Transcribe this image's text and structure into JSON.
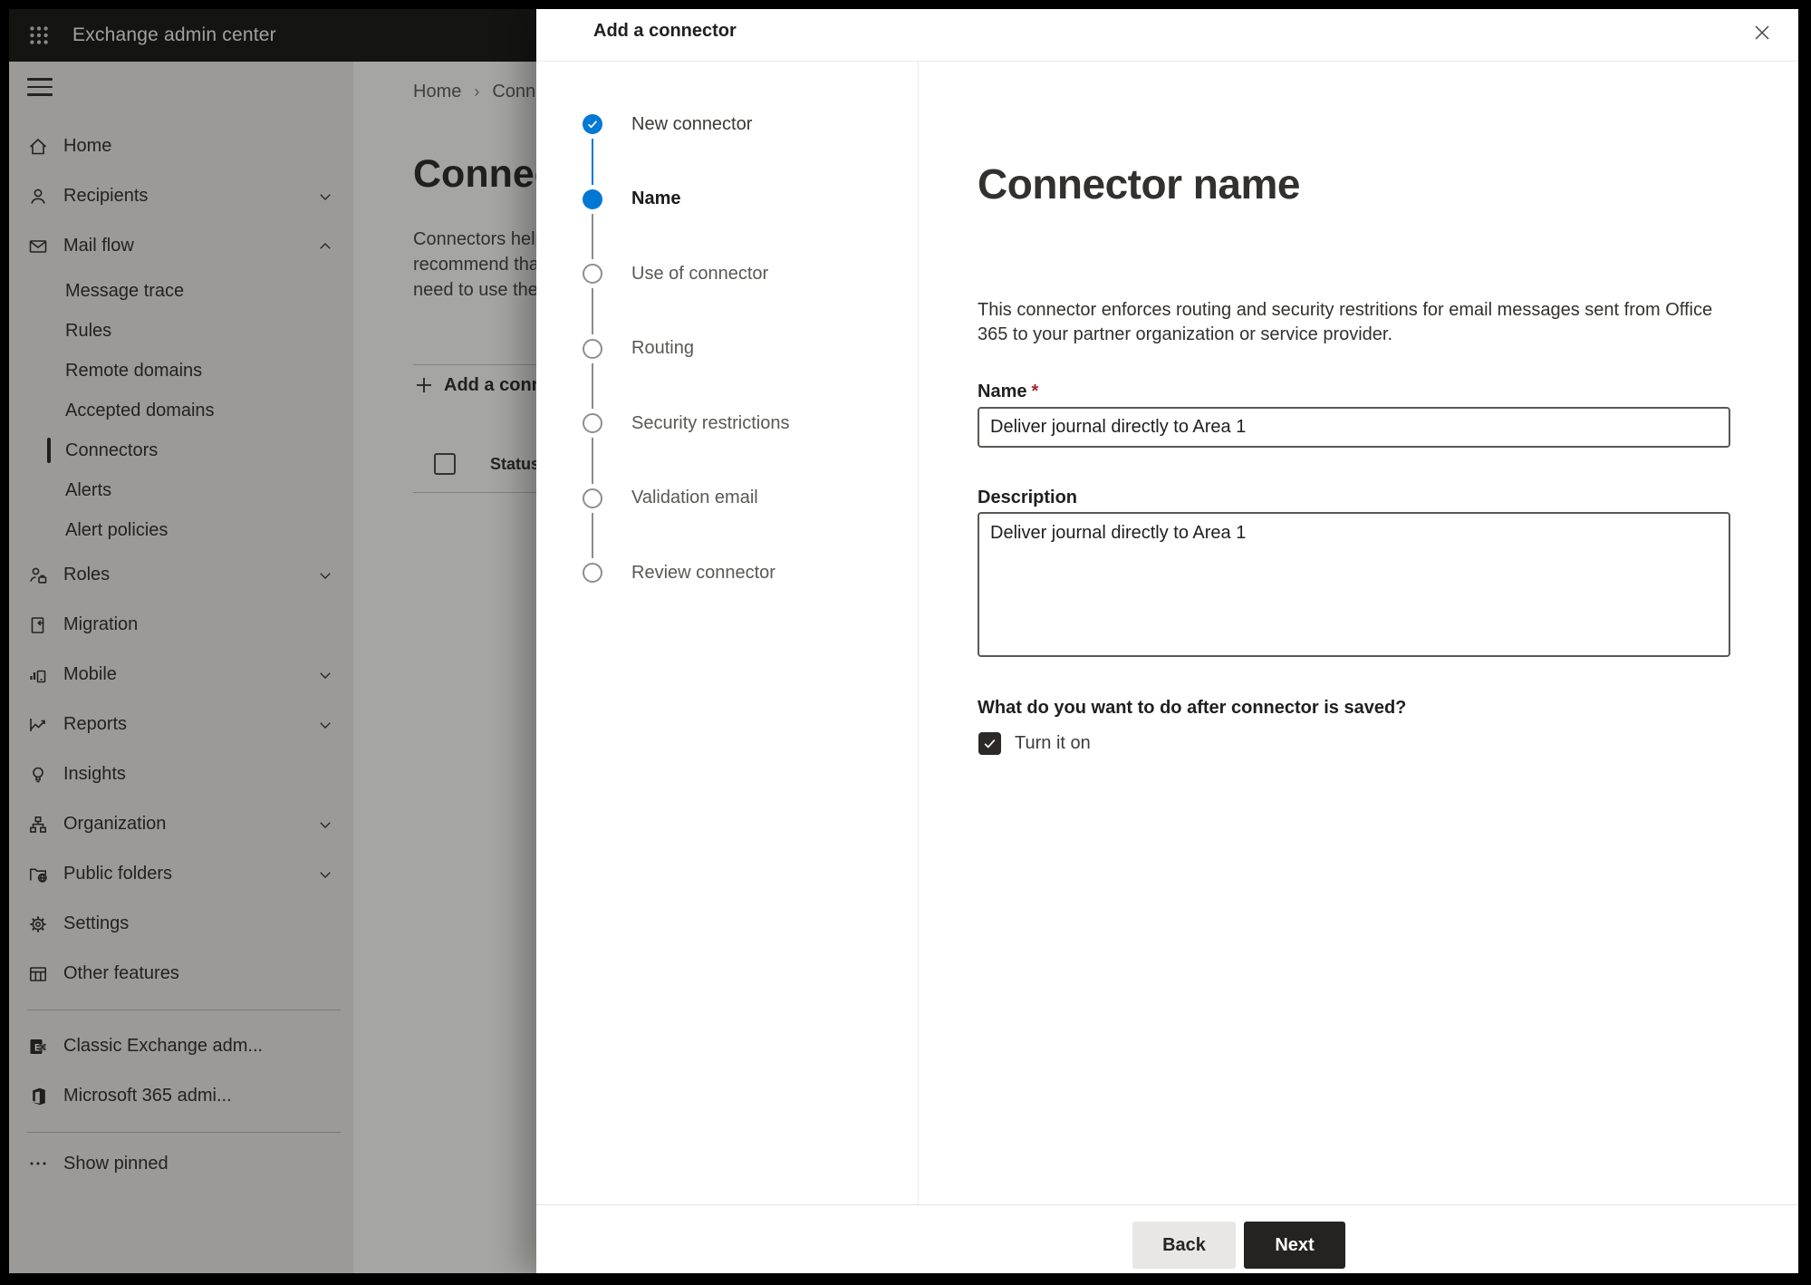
{
  "app": {
    "title": "Exchange admin center"
  },
  "sidebar": {
    "items": [
      {
        "label": "Home",
        "icon": "home-icon",
        "type": "top"
      },
      {
        "label": "Recipients",
        "icon": "person-icon",
        "type": "top",
        "chevron": "down"
      },
      {
        "label": "Mail flow",
        "icon": "mail-icon",
        "type": "top",
        "chevron": "up"
      },
      {
        "label": "Message trace",
        "type": "sub"
      },
      {
        "label": "Rules",
        "type": "sub"
      },
      {
        "label": "Remote domains",
        "type": "sub"
      },
      {
        "label": "Accepted domains",
        "type": "sub"
      },
      {
        "label": "Connectors",
        "type": "sub",
        "selected": true
      },
      {
        "label": "Alerts",
        "type": "sub"
      },
      {
        "label": "Alert policies",
        "type": "sub"
      },
      {
        "label": "Roles",
        "icon": "roles-icon",
        "type": "top",
        "chevron": "down"
      },
      {
        "label": "Migration",
        "icon": "migration-icon",
        "type": "top"
      },
      {
        "label": "Mobile",
        "icon": "mobile-icon",
        "type": "top",
        "chevron": "down"
      },
      {
        "label": "Reports",
        "icon": "reports-icon",
        "type": "top",
        "chevron": "down"
      },
      {
        "label": "Insights",
        "icon": "insights-icon",
        "type": "top"
      },
      {
        "label": "Organization",
        "icon": "organization-icon",
        "type": "top",
        "chevron": "down"
      },
      {
        "label": "Public folders",
        "icon": "public-folders-icon",
        "type": "top",
        "chevron": "down"
      },
      {
        "label": "Settings",
        "icon": "settings-icon",
        "type": "top"
      },
      {
        "label": "Other features",
        "icon": "other-features-icon",
        "type": "top"
      },
      {
        "type": "divider"
      },
      {
        "label": "Classic Exchange adm...",
        "icon": "exchange-logo-icon",
        "type": "top"
      },
      {
        "label": "Microsoft 365 admi...",
        "icon": "microsoft365-logo-icon",
        "type": "top"
      },
      {
        "type": "divider"
      },
      {
        "label": "Show pinned",
        "icon": "ellipsis-icon",
        "type": "sp"
      }
    ]
  },
  "page": {
    "breadcrumb": {
      "home": "Home",
      "separator": "›",
      "current": "Conne"
    },
    "heading": "Connect",
    "intro_lines": [
      "Connectors help",
      "recommend that",
      "need to use ther"
    ],
    "add_button_label": "Add a conn",
    "table": {
      "status_header": "Status"
    }
  },
  "modal": {
    "title": "Add a connector",
    "steps": [
      {
        "label": "New connector",
        "state": "done"
      },
      {
        "label": "Name",
        "state": "current"
      },
      {
        "label": "Use of connector",
        "state": "todo"
      },
      {
        "label": "Routing",
        "state": "todo"
      },
      {
        "label": "Security restrictions",
        "state": "todo"
      },
      {
        "label": "Validation email",
        "state": "todo"
      },
      {
        "label": "Review connector",
        "state": "todo"
      }
    ],
    "content": {
      "title": "Connector name",
      "description": "This connector enforces routing and security restritions for email messages sent from Office 365 to your partner organization or service provider.",
      "name_label": "Name",
      "required_marker": "*",
      "name_value": "Deliver journal directly to Area 1",
      "description_label": "Description",
      "description_value": "Deliver journal directly to Area 1",
      "after_save_question": "What do you want to do after connector is saved?",
      "turn_on_label": "Turn it on",
      "turn_on_checked": true
    },
    "footer": {
      "back_label": "Back",
      "next_label": "Next"
    }
  },
  "colors": {
    "accent": "#0078d4",
    "required": "#a4262c",
    "next_button_bg": "#242322",
    "step_inactive": "#908e8c"
  }
}
